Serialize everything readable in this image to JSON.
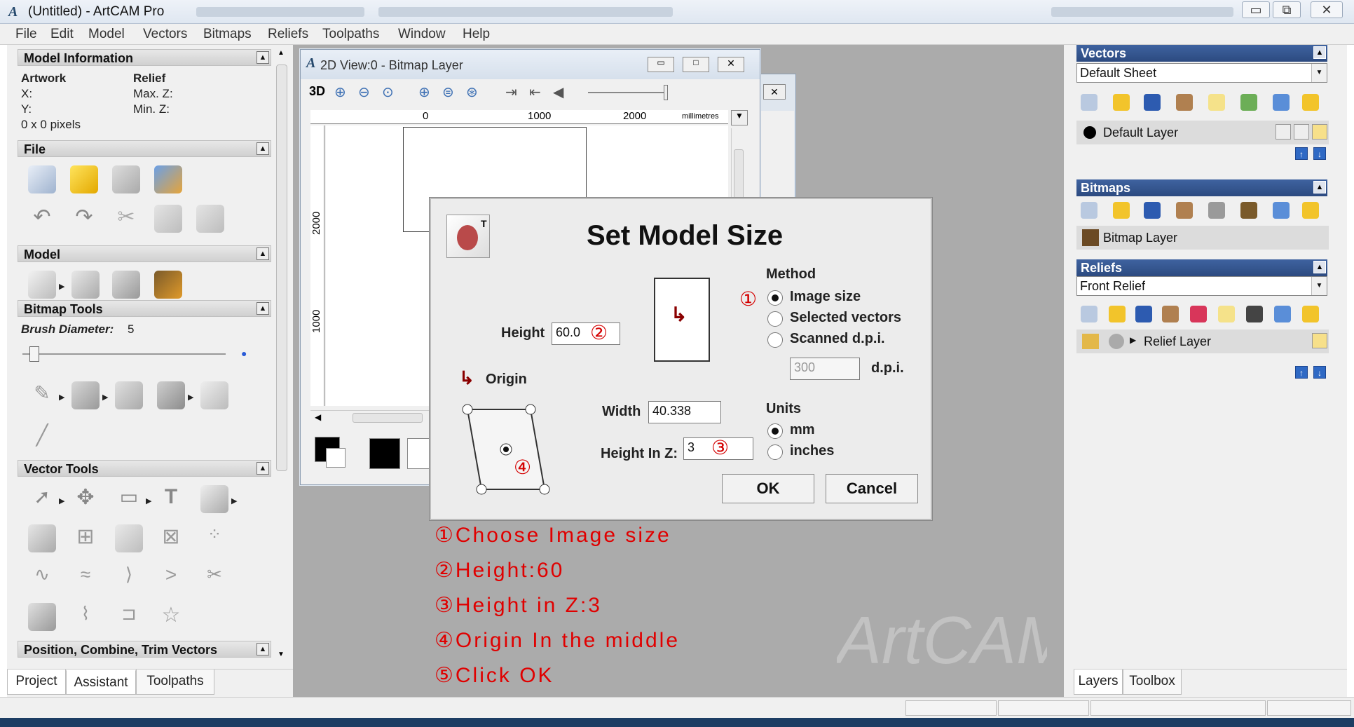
{
  "window": {
    "title": "(Untitled) - ArtCAM Pro",
    "min": "▭",
    "restore": "⧉",
    "close": "✕"
  },
  "menu": [
    "File",
    "Edit",
    "Model",
    "Vectors",
    "Bitmaps",
    "Reliefs",
    "Toolpaths",
    "Window",
    "Help"
  ],
  "left_panel": {
    "model_info": {
      "header": "Model Information",
      "artwork": "Artwork",
      "relief": "Relief",
      "x": "X:",
      "y": "Y:",
      "max_z": "Max. Z:",
      "min_z": "Min. Z:",
      "size": "0 x 0 pixels"
    },
    "file": {
      "header": "File"
    },
    "model": {
      "header": "Model"
    },
    "bitmap_tools": {
      "header": "Bitmap Tools",
      "brush_label": "Brush Diameter:",
      "brush_value": "5"
    },
    "vector_tools": {
      "header": "Vector Tools"
    },
    "position": {
      "header": "Position, Combine, Trim Vectors"
    },
    "tabs": [
      "Project",
      "Assistant",
      "Toolpaths"
    ]
  },
  "view2d": {
    "title": "2D View:0 - Bitmap Layer",
    "btn_3d": "3D",
    "ruler_units": "millimetres",
    "ruler_x": [
      "0",
      "1000",
      "2000"
    ],
    "ruler_y": [
      "2000",
      "1000"
    ]
  },
  "dialog": {
    "title": "Set Model Size",
    "height_label": "Height",
    "height_value": "60.0",
    "width_label": "Width",
    "width_value": "40.338",
    "height_z_label": "Height In Z:",
    "height_z_value": "3",
    "origin_label": "Origin",
    "method_label": "Method",
    "method_options": [
      "Image size",
      "Selected vectors",
      "Scanned d.p.i."
    ],
    "dpi_value": "300",
    "dpi_label": "d.p.i.",
    "units_label": "Units",
    "unit_options": [
      "mm",
      "inches"
    ],
    "ok": "OK",
    "cancel": "Cancel",
    "markers": [
      "①",
      "②",
      "③",
      "④",
      "⑤"
    ]
  },
  "annotations": [
    "①Choose Image size",
    "②Height:60",
    "③Height in Z:3",
    "④Origin In the middle",
    "⑤Click OK"
  ],
  "watermark": "ArtCAM",
  "right_panel": {
    "vectors": {
      "header": "Vectors",
      "sheet": "Default Sheet",
      "layer": "Default Layer"
    },
    "bitmaps": {
      "header": "Bitmaps",
      "layer": "Bitmap Layer"
    },
    "reliefs": {
      "header": "Reliefs",
      "relief": "Front Relief",
      "layer": "Relief Layer"
    },
    "tabs": [
      "Layers",
      "Toolbox"
    ]
  },
  "colors": {
    "accent": "#2c4a80",
    "annotation": "#e00000",
    "workspace": "#ababab"
  }
}
